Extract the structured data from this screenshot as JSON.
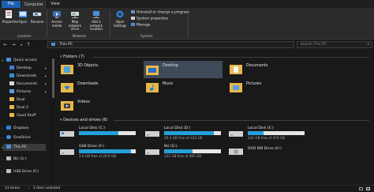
{
  "ribbon_tabs": [
    {
      "label": "File"
    },
    {
      "label": "Computer"
    },
    {
      "label": "View"
    }
  ],
  "ribbon": {
    "location": {
      "properties": "Properties",
      "open": "Open",
      "rename": "Rename",
      "group_label": "Location"
    },
    "network": {
      "access_media": "Access media",
      "map_network_drive": "Map network drive",
      "add_network_location": "Add a network location",
      "group_label": "Network"
    },
    "system": {
      "open_settings": "Open Settings",
      "uninstall": "Uninstall or change a program",
      "system_properties": "System properties",
      "manage": "Manage",
      "group_label": "System"
    }
  },
  "address": {
    "path": "This PC",
    "search_placeholder": "Search This PC"
  },
  "nav": {
    "quick_access": "Quick access",
    "items": [
      {
        "label": "Desktop"
      },
      {
        "label": "Downloads"
      },
      {
        "label": "Documents"
      },
      {
        "label": "Pictures"
      },
      {
        "label": "Dual"
      },
      {
        "label": "Dual 2"
      },
      {
        "label": "Good Stuff"
      },
      {
        "label": "Dropbox"
      },
      {
        "label": "OneDrive"
      },
      {
        "label": "This PC"
      },
      {
        "label": "BU (G:)"
      },
      {
        "label": "USB Drive (F:)"
      }
    ]
  },
  "folders_header": "Folders (7)",
  "folders": [
    {
      "name": "3D Objects"
    },
    {
      "name": "Desktop"
    },
    {
      "name": "Documents"
    },
    {
      "name": "Downloads"
    },
    {
      "name": "Music"
    },
    {
      "name": "Pictures"
    },
    {
      "name": "Videos"
    }
  ],
  "drives_header": "Devices and drives (6)",
  "drives": [
    {
      "name": "Local Disk (C:)",
      "free": "",
      "used_fraction": 0.7
    },
    {
      "name": "Local Disk (D:)",
      "free": "29.4 GB free of 222 GB",
      "used_fraction": 0.87
    },
    {
      "name": "Local Disk (E:)",
      "free": "341 GB free of 476 GB",
      "used_fraction": 0.28
    },
    {
      "name": "USB Drive (F:)",
      "free": "2.6 GB free of 29.6 GB",
      "used_fraction": 0.91
    },
    {
      "name": "BU (G:)",
      "free": "232 GB free of 465 GB",
      "used_fraction": 0.5
    },
    {
      "name": "DVD RW Drive (H:)",
      "free": "",
      "used_fraction": null
    }
  ],
  "status": {
    "items": "13 items",
    "selected": "1 item selected"
  },
  "colors": {
    "accent": "#1a5fb4",
    "drive_fill": "#26a0da",
    "folder": "#e8b84a"
  }
}
